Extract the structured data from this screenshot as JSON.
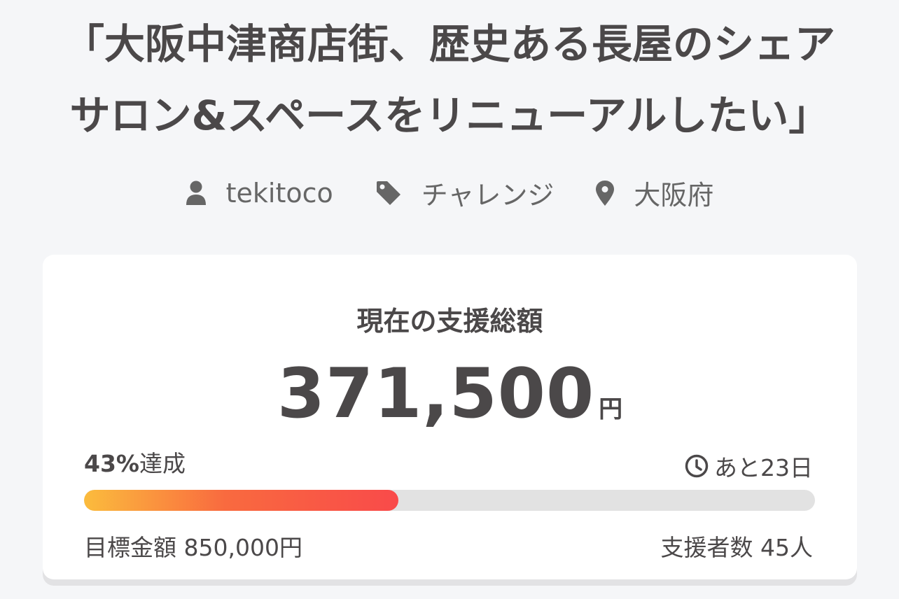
{
  "project": {
    "title_line1": "「大阪中津商店街、歴史ある長屋のシェア",
    "title_line2": "サロン&スペースをリニューアルしたい」",
    "owner": "tekitoco",
    "category": "チャレンジ",
    "location": "大阪府"
  },
  "icons": {
    "owner": "user-icon",
    "category": "tag-icon",
    "location": "map-pin-icon",
    "remaining": "clock-icon"
  },
  "funding": {
    "heading": "現在の支援総額",
    "amount": "371,500",
    "currency": "円",
    "percent": "43%",
    "percent_suffix": "達成",
    "progress_fraction": 0.43,
    "remaining": "あと23日",
    "goal": "目標金額 850,000円",
    "backers": "支援者数 45人"
  },
  "colors": {
    "background": "#f5f6f8",
    "card": "#ffffff",
    "text": "#4b4849",
    "progress_start": "#fbbc3d",
    "progress_end": "#f94a4a",
    "progress_track": "#e2e2e2"
  }
}
